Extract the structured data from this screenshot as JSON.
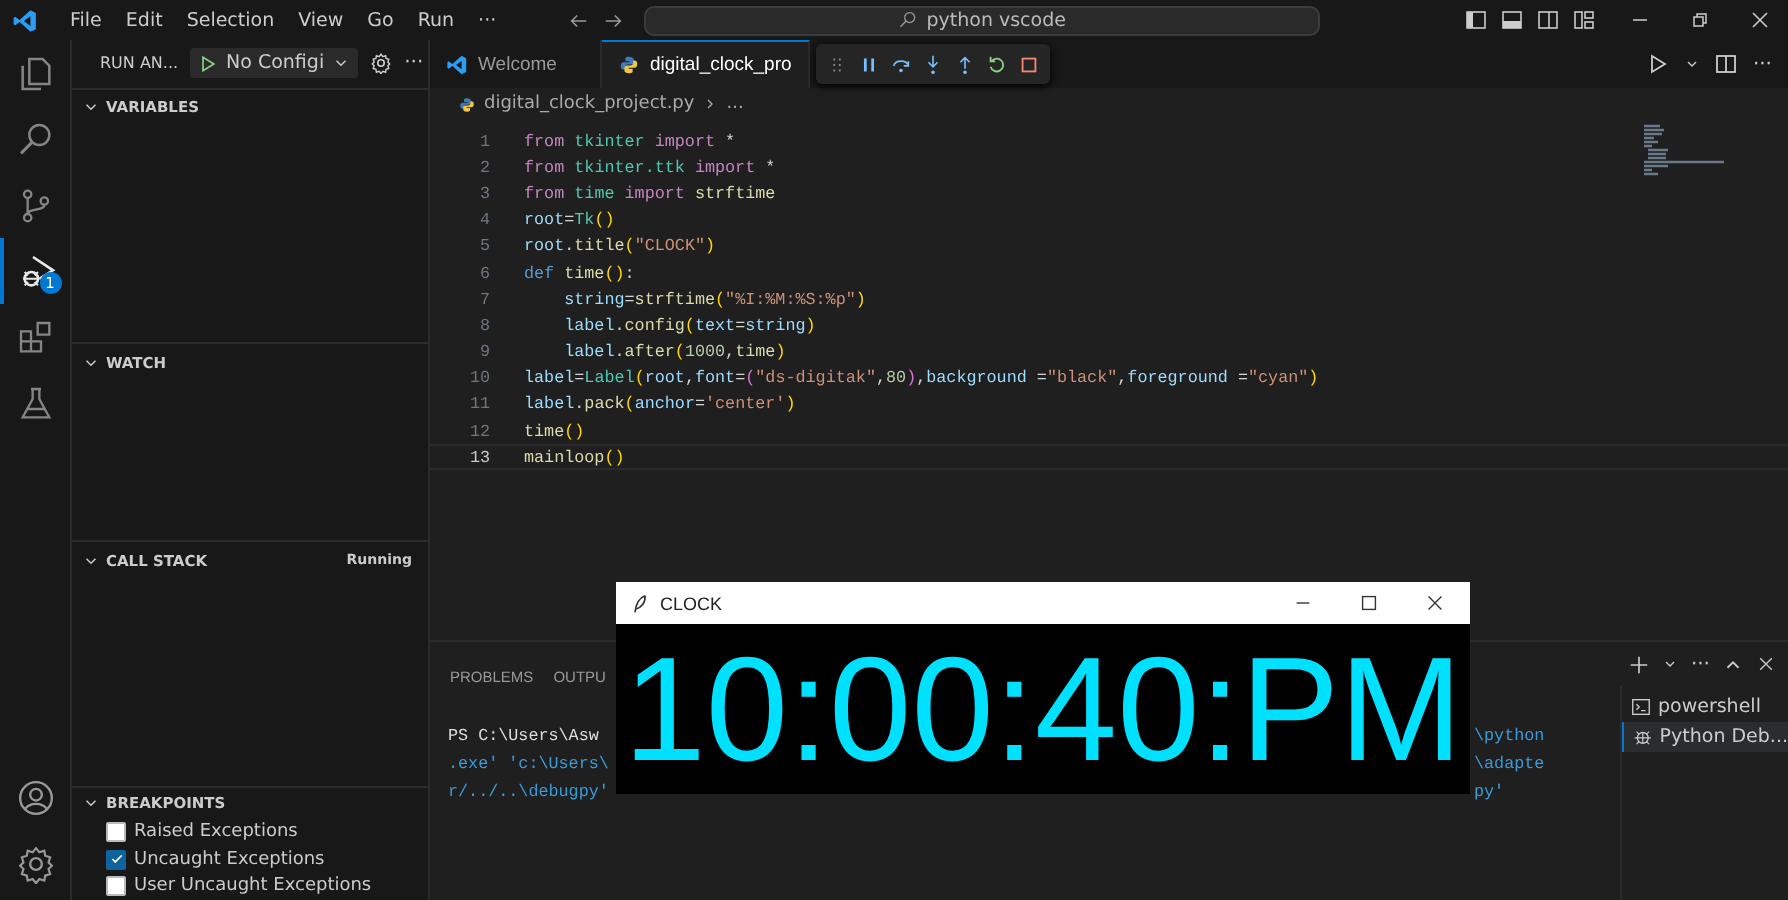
{
  "title_bar": {
    "menus": [
      "File",
      "Edit",
      "Selection",
      "View",
      "Go",
      "Run",
      "···"
    ],
    "search": {
      "value": "python vscode"
    }
  },
  "activity_bar": {
    "items": [
      {
        "kind": "explorer",
        "selected": false
      },
      {
        "kind": "search",
        "selected": false
      },
      {
        "kind": "source-control",
        "selected": false
      },
      {
        "kind": "run-debug",
        "selected": true,
        "badge": "1"
      },
      {
        "kind": "extensions",
        "selected": false
      },
      {
        "kind": "testing",
        "selected": false
      }
    ],
    "bottom": [
      {
        "kind": "account"
      },
      {
        "kind": "settings"
      }
    ]
  },
  "sidebar": {
    "title": "RUN AN...",
    "run_config": "No Configi",
    "more": "···",
    "sections": [
      {
        "title": "VARIABLES",
        "expanded": true
      },
      {
        "title": "WATCH",
        "expanded": true
      },
      {
        "title": "CALL STACK",
        "expanded": true,
        "status": "Running"
      },
      {
        "title": "BREAKPOINTS",
        "expanded": true,
        "items": [
          {
            "label": "Raised Exceptions",
            "checked": false
          },
          {
            "label": "Uncaught Exceptions",
            "checked": true
          },
          {
            "label": "User Uncaught Exceptions",
            "checked": false
          }
        ]
      }
    ]
  },
  "editor": {
    "tabs": [
      {
        "label": "Welcome",
        "selected": false
      },
      {
        "label": "digital_clock_pro",
        "selected": true
      }
    ],
    "more": "···",
    "breadcrumb": [
      "digital_clock_project.py",
      "..."
    ],
    "lines": [
      {
        "number": "1",
        "current": false,
        "tokens": [
          {
            "text": "from ",
            "kind": "kw"
          },
          {
            "text": "tkinter ",
            "kind": "mod"
          },
          {
            "text": "import ",
            "kind": "kw"
          },
          {
            "text": "*",
            "kind": "punc"
          }
        ]
      },
      {
        "number": "2",
        "current": false,
        "tokens": [
          {
            "text": "from ",
            "kind": "kw"
          },
          {
            "text": "tkinter.ttk ",
            "kind": "mod"
          },
          {
            "text": "import ",
            "kind": "kw"
          },
          {
            "text": "*",
            "kind": "punc"
          }
        ]
      },
      {
        "number": "3",
        "current": false,
        "tokens": [
          {
            "text": "from ",
            "kind": "kw"
          },
          {
            "text": "time ",
            "kind": "mod"
          },
          {
            "text": "import ",
            "kind": "kw"
          },
          {
            "text": "strftime",
            "kind": "fn"
          }
        ]
      },
      {
        "number": "4",
        "current": false,
        "tokens": [
          {
            "text": "root",
            "kind": "var"
          },
          {
            "text": "=",
            "kind": "punc"
          },
          {
            "text": "Tk",
            "kind": "mod"
          },
          {
            "text": "()",
            "kind": "paren"
          }
        ]
      },
      {
        "number": "5",
        "current": false,
        "tokens": [
          {
            "text": "root",
            "kind": "var"
          },
          {
            "text": ".",
            "kind": "punc"
          },
          {
            "text": "title",
            "kind": "fn"
          },
          {
            "text": "(",
            "kind": "paren"
          },
          {
            "text": "\"CLOCK\"",
            "kind": "str"
          },
          {
            "text": ")",
            "kind": "paren"
          }
        ]
      },
      {
        "number": "6",
        "current": false,
        "tokens": [
          {
            "text": "def ",
            "kind": "def"
          },
          {
            "text": "time",
            "kind": "fn"
          },
          {
            "text": "()",
            "kind": "paren"
          },
          {
            "text": ":",
            "kind": "punc"
          }
        ]
      },
      {
        "number": "7",
        "current": false,
        "tokens": [
          {
            "text": "    string",
            "kind": "var"
          },
          {
            "text": "=",
            "kind": "punc"
          },
          {
            "text": "strftime",
            "kind": "fn"
          },
          {
            "text": "(",
            "kind": "paren"
          },
          {
            "text": "\"%I:%M:%S:%p\"",
            "kind": "str"
          },
          {
            "text": ")",
            "kind": "paren"
          }
        ]
      },
      {
        "number": "8",
        "current": false,
        "tokens": [
          {
            "text": "    label",
            "kind": "var"
          },
          {
            "text": ".",
            "kind": "punc"
          },
          {
            "text": "config",
            "kind": "fn"
          },
          {
            "text": "(",
            "kind": "paren"
          },
          {
            "text": "text",
            "kind": "var"
          },
          {
            "text": "=",
            "kind": "punc"
          },
          {
            "text": "string",
            "kind": "var"
          },
          {
            "text": ")",
            "kind": "paren"
          }
        ]
      },
      {
        "number": "9",
        "current": false,
        "tokens": [
          {
            "text": "    label",
            "kind": "var"
          },
          {
            "text": ".",
            "kind": "punc"
          },
          {
            "text": "after",
            "kind": "fn"
          },
          {
            "text": "(",
            "kind": "paren"
          },
          {
            "text": "1000",
            "kind": "num"
          },
          {
            "text": ",",
            "kind": "punc"
          },
          {
            "text": "time",
            "kind": "fn"
          },
          {
            "text": ")",
            "kind": "paren"
          }
        ]
      },
      {
        "number": "10",
        "current": false,
        "tokens": [
          {
            "text": "label",
            "kind": "var"
          },
          {
            "text": "=",
            "kind": "punc"
          },
          {
            "text": "Label",
            "kind": "mod"
          },
          {
            "text": "(",
            "kind": "paren"
          },
          {
            "text": "root",
            "kind": "var"
          },
          {
            "text": ",",
            "kind": "punc"
          },
          {
            "text": "font",
            "kind": "var"
          },
          {
            "text": "=",
            "kind": "punc"
          },
          {
            "text": "(",
            "kind": "paren2"
          },
          {
            "text": "\"ds-digitak\"",
            "kind": "str"
          },
          {
            "text": ",",
            "kind": "punc"
          },
          {
            "text": "80",
            "kind": "num"
          },
          {
            "text": ")",
            "kind": "paren2"
          },
          {
            "text": ",",
            "kind": "punc"
          },
          {
            "text": "background",
            "kind": "var"
          },
          {
            "text": " =",
            "kind": "punc"
          },
          {
            "text": "\"black\"",
            "kind": "str"
          },
          {
            "text": ",",
            "kind": "punc"
          },
          {
            "text": "foreground",
            "kind": "var"
          },
          {
            "text": " =",
            "kind": "punc"
          },
          {
            "text": "\"cyan\"",
            "kind": "str"
          },
          {
            "text": ")",
            "kind": "paren"
          }
        ]
      },
      {
        "number": "11",
        "current": false,
        "tokens": [
          {
            "text": "label",
            "kind": "var"
          },
          {
            "text": ".",
            "kind": "punc"
          },
          {
            "text": "pack",
            "kind": "fn"
          },
          {
            "text": "(",
            "kind": "paren"
          },
          {
            "text": "anchor",
            "kind": "var"
          },
          {
            "text": "=",
            "kind": "punc"
          },
          {
            "text": "'center'",
            "kind": "str"
          },
          {
            "text": ")",
            "kind": "paren"
          }
        ]
      },
      {
        "number": "12",
        "current": false,
        "tokens": [
          {
            "text": "time",
            "kind": "fn"
          },
          {
            "text": "()",
            "kind": "paren"
          }
        ]
      },
      {
        "number": "13",
        "current": true,
        "tokens": [
          {
            "text": "mainloop",
            "kind": "fn"
          },
          {
            "text": "()",
            "kind": "paren"
          }
        ]
      }
    ]
  },
  "panel": {
    "tabs": [
      {
        "label": "PROBLEMS",
        "selected": false
      },
      {
        "label": "OUTPU",
        "selected": false
      }
    ],
    "more": "···",
    "terminal_lines": [
      {
        "start": "PS C:\\Users\\Asw",
        "end": "\\python"
      },
      {
        "start": ".exe' 'c:\\Users\\",
        "end": "\\adapte"
      },
      {
        "start": "r/../..\\debugpy'",
        "end": "py'"
      }
    ],
    "terminals": [
      {
        "label": "powershell",
        "kind": "shell",
        "selected": false
      },
      {
        "label": "Python Deb...",
        "kind": "debug",
        "selected": true
      }
    ]
  },
  "clock_window": {
    "title": "CLOCK",
    "time": "10:00:40:PM"
  }
}
